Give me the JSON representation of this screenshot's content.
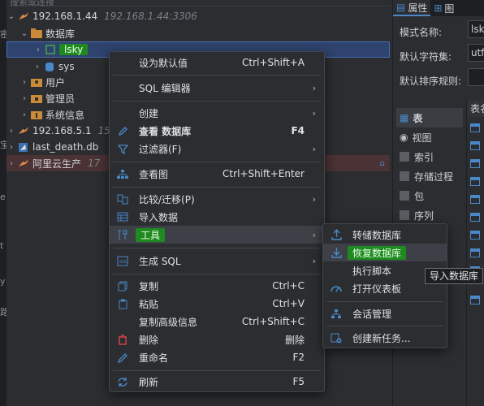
{
  "tree": {
    "search_placeholder": "搜索或连接",
    "connection": {
      "name": "192.168.1.44",
      "address": "192.168.1.44:3306"
    },
    "databases_folder": "数据库",
    "db_lsky": "lsky",
    "db_sys": "sys",
    "users_folder": "用户",
    "admins_folder": "管理员",
    "sysinfo_folder": "系统信息",
    "conn2": {
      "name": "192.168.5.1",
      "address": "15"
    },
    "db_file": "last_death.db",
    "conn3": {
      "name": "阿里云生产",
      "address": "17"
    }
  },
  "right_panel": {
    "tabs": [
      "属性",
      "图"
    ],
    "fields": [
      {
        "label": "模式名称:",
        "value": "lsky"
      },
      {
        "label": "默认字符集:",
        "value": "utf"
      },
      {
        "label": "默认排序规则:",
        "value": ""
      }
    ],
    "objects": [
      "表",
      "视图",
      "索引",
      "存储过程",
      "包",
      "序列"
    ],
    "tables_header": "表名"
  },
  "context_menu": {
    "items": [
      {
        "label": "设为默认值",
        "shortcut": "Ctrl+Shift+A",
        "icon": "",
        "arrow": false,
        "bold": false
      },
      {
        "label": "SQL 编辑器",
        "shortcut": "",
        "icon": "",
        "arrow": true,
        "bold": false
      },
      {
        "label": "创建",
        "shortcut": "",
        "icon": "",
        "arrow": true,
        "bold": false
      },
      {
        "label": "查看 数据库",
        "shortcut": "F4",
        "icon": "pencil-icon",
        "arrow": false,
        "bold": true
      },
      {
        "label": "过滤器(F)",
        "shortcut": "",
        "icon": "filter-icon",
        "arrow": true,
        "bold": false
      },
      {
        "label": "查看图",
        "shortcut": "Ctrl+Shift+Enter",
        "icon": "diagram-icon",
        "arrow": false,
        "bold": false
      },
      {
        "label": "比较/迁移(P)",
        "shortcut": "",
        "icon": "compare-icon",
        "arrow": true,
        "bold": false
      },
      {
        "label": "导入数据",
        "shortcut": "",
        "icon": "table-icon",
        "arrow": false,
        "bold": false
      },
      {
        "label": "工具",
        "shortcut": "",
        "icon": "tools-icon",
        "arrow": true,
        "bold": false
      },
      {
        "label": "生成 SQL",
        "shortcut": "",
        "icon": "sql-icon",
        "arrow": true,
        "bold": false
      },
      {
        "label": "复制",
        "shortcut": "Ctrl+C",
        "icon": "copy-icon",
        "arrow": false,
        "bold": false
      },
      {
        "label": "粘贴",
        "shortcut": "Ctrl+V",
        "icon": "paste-icon",
        "arrow": false,
        "bold": false
      },
      {
        "label": "复制高级信息",
        "shortcut": "Ctrl+Shift+C",
        "icon": "",
        "arrow": false,
        "bold": false
      },
      {
        "label": "删除",
        "shortcut": "删除",
        "icon": "trash-icon",
        "arrow": false,
        "bold": false
      },
      {
        "label": "重命名",
        "shortcut": "F2",
        "icon": "rename-icon",
        "arrow": false,
        "bold": false
      },
      {
        "label": "刷新",
        "shortcut": "F5",
        "icon": "refresh-icon",
        "arrow": false,
        "bold": false
      }
    ]
  },
  "submenu": {
    "items": [
      {
        "label": "转储数据库",
        "icon": "dump-icon"
      },
      {
        "label": "恢复数据库",
        "icon": "restore-icon"
      },
      {
        "label": "执行脚本",
        "icon": ""
      },
      {
        "label": "打开仪表板",
        "icon": "dashboard-icon"
      },
      {
        "label": "会话管理",
        "icon": "session-icon"
      },
      {
        "label": "创建新任务...",
        "icon": "new-task-icon"
      }
    ]
  },
  "tooltip": "导入数据库",
  "colors": {
    "highlight_green": "#1f8a1f",
    "accent_blue": "#4a88c7",
    "selection": "#2e436e"
  }
}
